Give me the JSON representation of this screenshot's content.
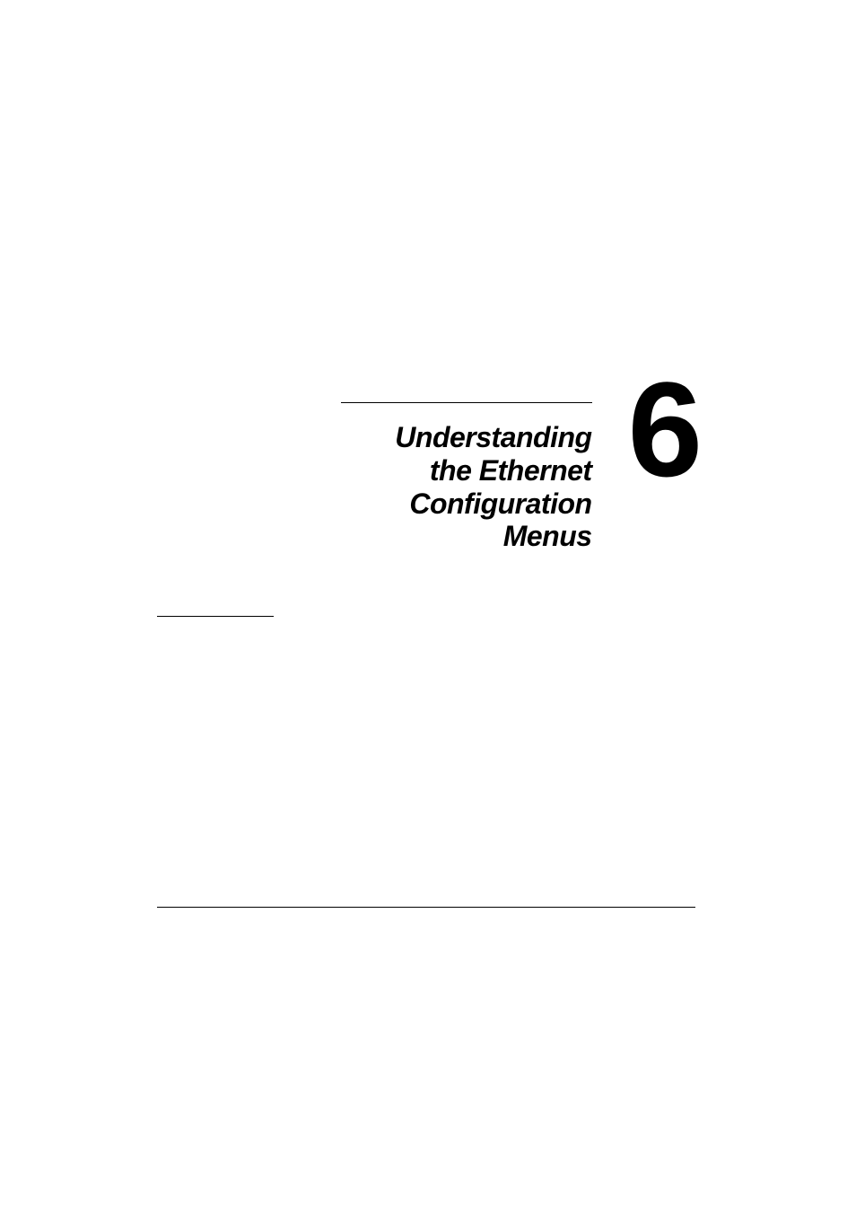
{
  "chapter": {
    "title_line1": "Understanding",
    "title_line2": "the Ethernet",
    "title_line3": "Configuration",
    "title_line4": "Menus",
    "number": "6"
  }
}
